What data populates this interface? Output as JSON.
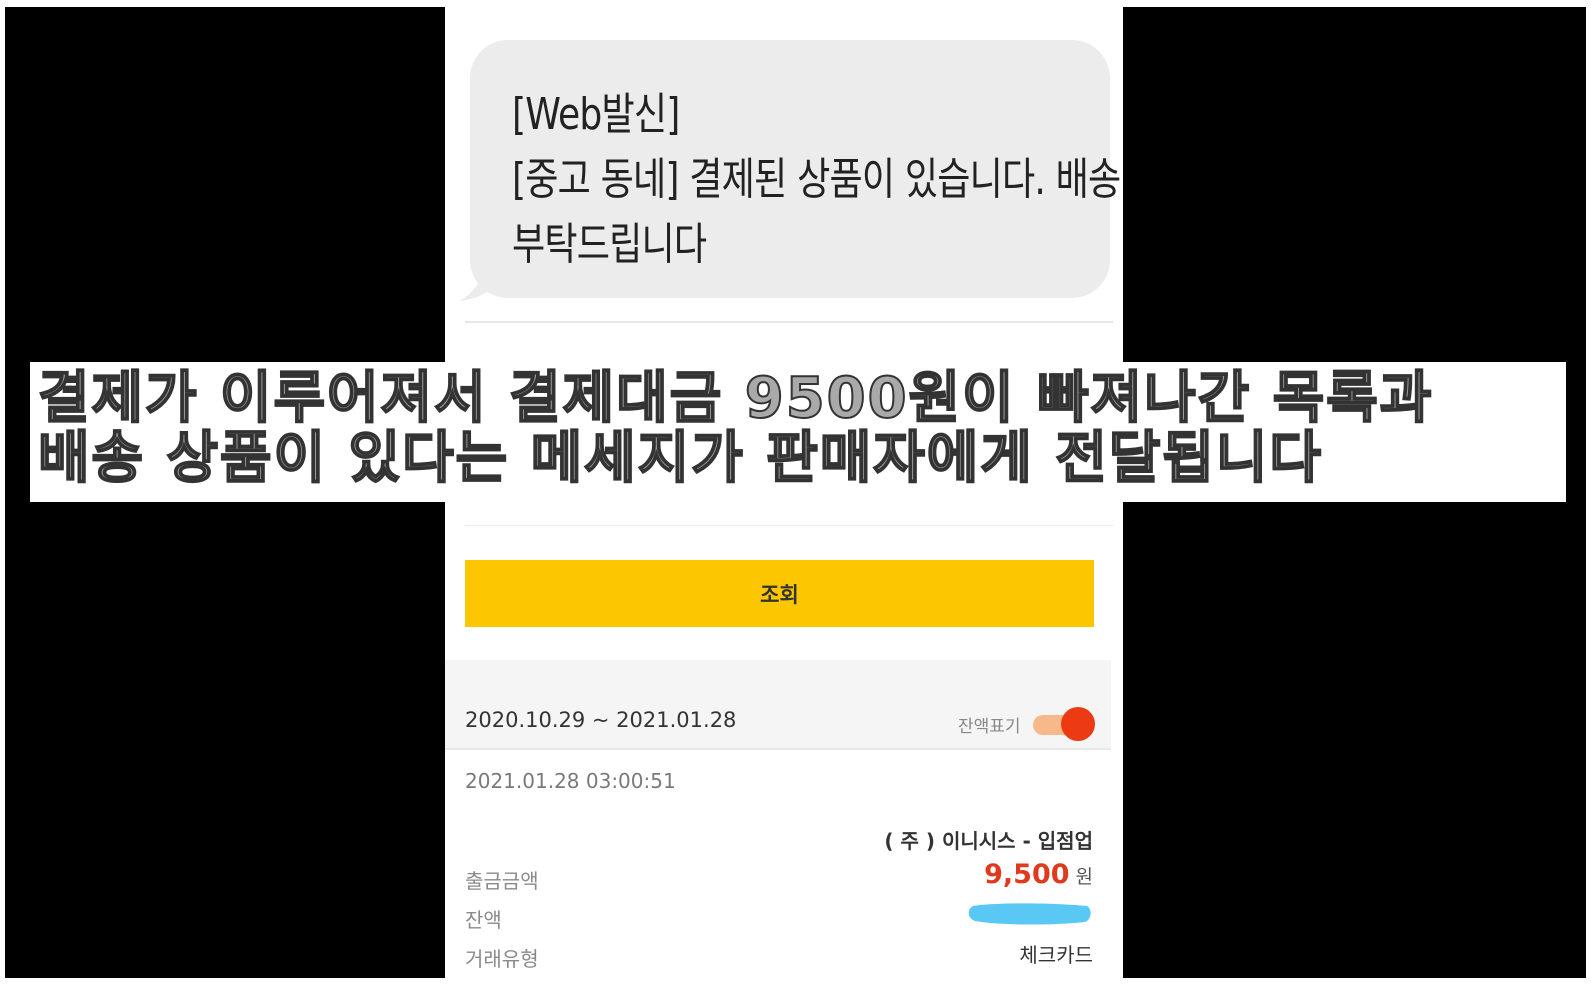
{
  "message": {
    "lines": [
      "[Web발신]",
      "[중고 동네] 결제된 상품이 있습니다. 배송",
      "부탁드립니다"
    ]
  },
  "query_button": {
    "label": "조회"
  },
  "period": {
    "range": "2020.10.29 ~ 2021.01.28",
    "balance_toggle_label": "잔액표기",
    "balance_toggle_on": true
  },
  "transaction": {
    "datetime": "2021.01.28 03:00:51",
    "merchant": "( 주 ) 이니시스 - 입점업",
    "amount_label": "출금금액",
    "amount_value": "9,500",
    "amount_unit": "원",
    "balance_label": "잔액",
    "type_label": "거래유형",
    "type_value": "체크카드"
  },
  "caption": {
    "lines": [
      "결제가 이루어져서 결제대금 9500원이 빠져나간 목록과",
      "배송 상품이 있다는 메세지가 판매자에게 전달됩니다"
    ]
  },
  "colors": {
    "accent_yellow": "#fcc600",
    "amount_red": "#e03a1e",
    "toggle_on": "#ec3a12",
    "mask_blue": "#5ac8f5"
  }
}
